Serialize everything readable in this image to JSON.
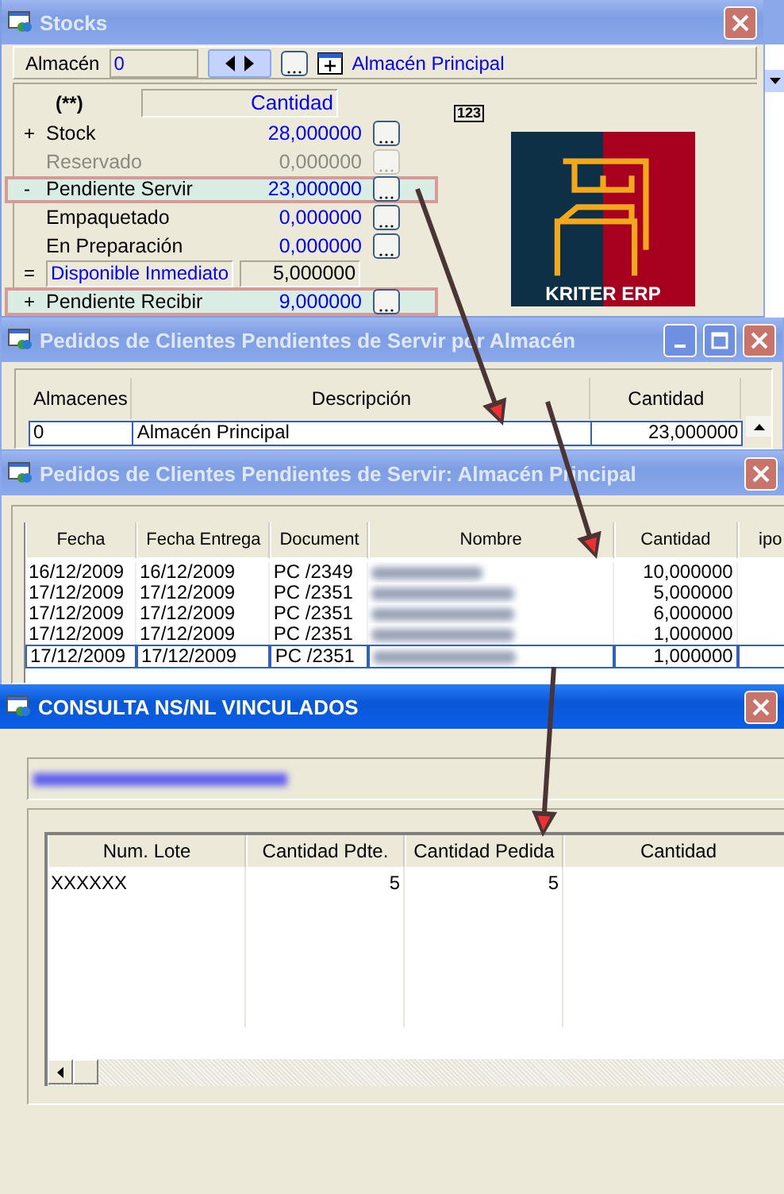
{
  "stocks_window": {
    "title": "Stocks",
    "active": false,
    "warehouse_label": "Almacén",
    "warehouse_code": "0",
    "warehouse_name": "Almacén Principal",
    "column_marker": "(**)",
    "column_heading": "Cantidad",
    "badge": "123",
    "logo_text": "KRITER ERP",
    "rows": [
      {
        "kind": "row",
        "sign": "+",
        "label": "Stock",
        "value": "28,000000",
        "disabled": false,
        "highlighted": false
      },
      {
        "kind": "row",
        "label": "Reservado",
        "value": "0,000000",
        "disabled": true,
        "highlighted": false
      },
      {
        "kind": "row",
        "sign": "-",
        "label": "Pendiente Servir",
        "value": "23,000000",
        "disabled": false,
        "highlighted": true
      },
      {
        "kind": "row",
        "label": "Empaquetado",
        "value": "0,000000",
        "disabled": false,
        "highlighted": false
      },
      {
        "kind": "row",
        "label": "En Preparación",
        "value": "0,000000",
        "disabled": false,
        "highlighted": false
      },
      {
        "kind": "total",
        "sign": "=",
        "label": "Disponible Inmediato",
        "value": "5,000000",
        "disabled": false,
        "highlighted": false
      },
      {
        "kind": "row",
        "sign": "+",
        "label": "Pendiente Recibir",
        "value": "9,000000",
        "disabled": false,
        "highlighted": true
      }
    ]
  },
  "warehouse_orders_window": {
    "title": "Pedidos de Clientes Pendientes de Servir por Almacén",
    "active": false,
    "columns": [
      "Almacenes",
      "Descripción",
      "Cantidad"
    ],
    "rows": [
      {
        "cells": [
          "0",
          "Almacén Principal",
          "23,000000"
        ],
        "selected": true
      }
    ]
  },
  "orders_window": {
    "title": "Pedidos de Clientes Pendientes de Servir: Almacén Principal",
    "active": false,
    "columns": [
      "Fecha",
      "Fecha Entrega",
      "Document",
      "Nombre",
      "Cantidad",
      "ipo"
    ],
    "rows": [
      {
        "cells": [
          "16/12/2009",
          "16/12/2009",
          "PC /2349",
          "",
          "10,000000",
          ""
        ],
        "selected": false
      },
      {
        "cells": [
          "17/12/2009",
          "17/12/2009",
          "PC /2351",
          "",
          "5,000000",
          ""
        ],
        "selected": false
      },
      {
        "cells": [
          "17/12/2009",
          "17/12/2009",
          "PC /2351",
          "",
          "6,000000",
          ""
        ],
        "selected": false
      },
      {
        "cells": [
          "17/12/2009",
          "17/12/2009",
          "PC /2351",
          "",
          "1,000000",
          ""
        ],
        "selected": false
      },
      {
        "cells": [
          "17/12/2009",
          "17/12/2009",
          "PC /2351",
          "",
          "1,000000",
          ""
        ],
        "selected": true
      }
    ]
  },
  "lots_window": {
    "title": "CONSULTA NS/NL VINCULADOS",
    "active": true,
    "columns": [
      "Num. Lote",
      "Cantidad Pdte.",
      "Cantidad Pedida",
      "Cantidad"
    ],
    "rows": [
      {
        "cells": [
          "XXXXXX",
          "5",
          "5",
          ""
        ]
      }
    ]
  }
}
